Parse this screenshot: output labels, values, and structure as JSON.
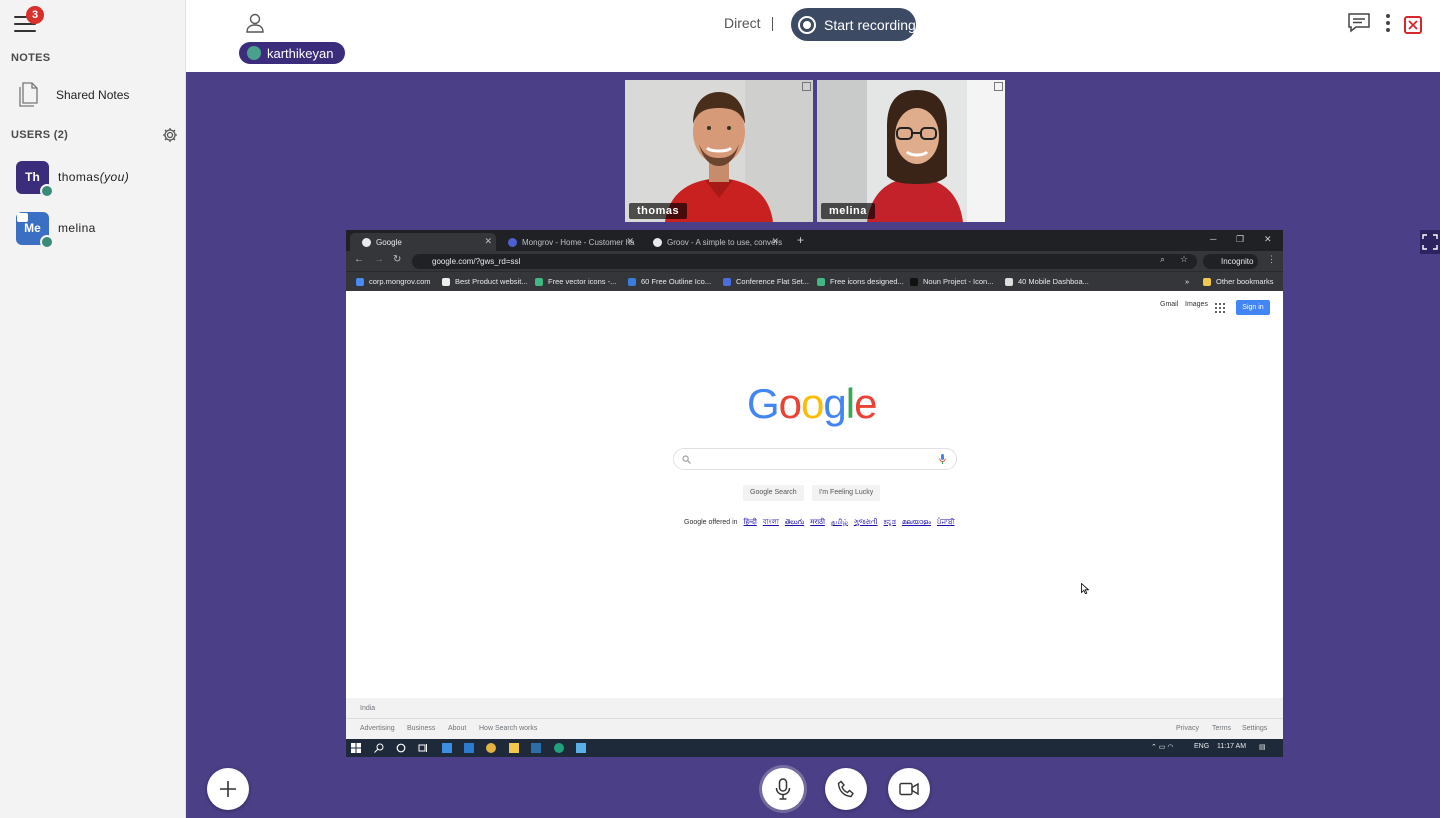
{
  "sidebar": {
    "notification_count": "3",
    "notes_title": "NOTES",
    "shared_notes_label": "Shared Notes",
    "users_title": "USERS (2)",
    "users": [
      {
        "initials": "Th",
        "name": "thomas",
        "suffix": "(you)",
        "avatar_color": "#3b2c7c"
      },
      {
        "initials": "Me",
        "name": "melina",
        "suffix": "",
        "avatar_color": "#3b6fc4"
      }
    ]
  },
  "topbar": {
    "presenter_name": "karthikeyan",
    "mode_label": "Direct",
    "record_label": "Start recording"
  },
  "cameras": [
    {
      "name": "thomas"
    },
    {
      "name": "melina"
    }
  ],
  "screen": {
    "tabs": [
      {
        "title": "Google"
      },
      {
        "title": "Mongrov - Home - Customer ha"
      },
      {
        "title": "Groov - A simple to use, convers"
      }
    ],
    "url": "google.com/?gws_rd=ssl",
    "profile_label": "Incognito",
    "bookmarks": [
      "corp.mongrov.com",
      "Best Product websit...",
      "Free vector icons -...",
      "60 Free Outline Ico...",
      "Conference Flat Set...",
      "Free icons designed...",
      "Noun Project - Icon...",
      "40 Mobile Dashboa..."
    ],
    "bookmarks_overflow": "»",
    "other_bookmarks": "Other bookmarks",
    "google": {
      "gmail": "Gmail",
      "images": "Images",
      "sign_in": "Sign in",
      "search_button": "Google Search",
      "lucky_button": "I'm Feeling Lucky",
      "offered_in": "Google offered in",
      "languages": [
        "हिन्दी",
        "বাংলা",
        "తెలుగు",
        "मराठी",
        "தமிழ்",
        "ગુજરાતી",
        "ಕನ್ನಡ",
        "മലയാളം",
        "ਪੰਜਾਬੀ"
      ],
      "country": "India",
      "footer_left": [
        "Advertising",
        "Business",
        "About",
        "How Search works"
      ],
      "footer_right": [
        "Privacy",
        "Terms",
        "Settings"
      ]
    },
    "taskbar": {
      "language": "ENG",
      "time": "11:17 AM"
    }
  },
  "colors": {
    "stage_bg": "#4b3f87",
    "presenter_pill": "#3b2c7c",
    "record_button": "#3d4a63",
    "close_red": "#d8262a"
  }
}
